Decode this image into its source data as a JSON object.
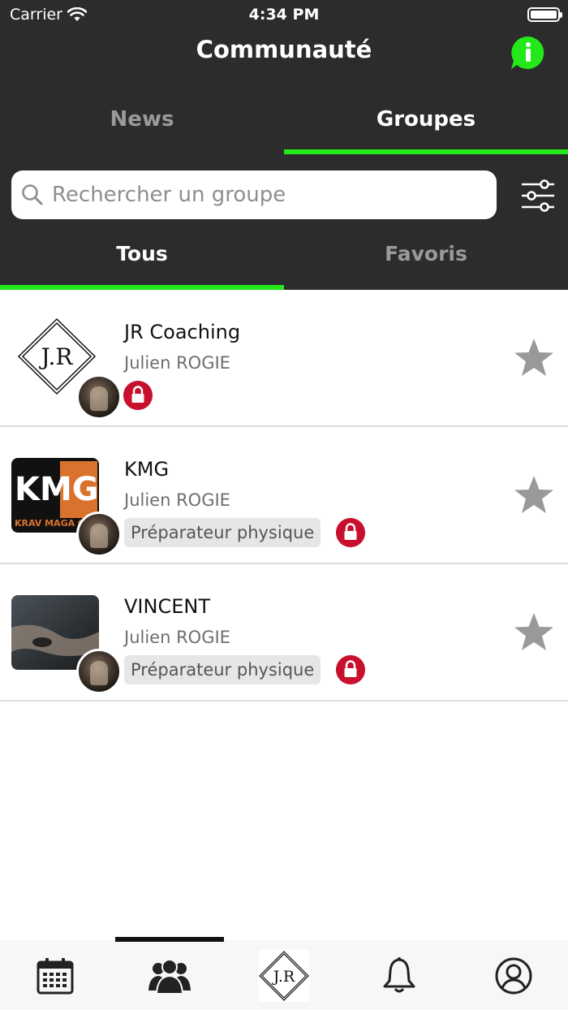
{
  "status_bar": {
    "carrier": "Carrier",
    "time": "4:34 PM"
  },
  "header": {
    "title": "Communauté",
    "info_icon": "info-bubble-icon",
    "accent_color": "#23e81a"
  },
  "top_tabs": [
    {
      "label": "News",
      "active": false
    },
    {
      "label": "Groupes",
      "active": true
    }
  ],
  "search": {
    "placeholder": "Rechercher un groupe",
    "icon": "search-icon",
    "filter_icon": "sliders-icon"
  },
  "sub_tabs": [
    {
      "label": "Tous",
      "active": true
    },
    {
      "label": "Favoris",
      "active": false
    }
  ],
  "groups": [
    {
      "name": "JR Coaching",
      "owner": "Julien ROGIE",
      "tag": "",
      "locked": true,
      "logo_text": "J.R"
    },
    {
      "name": "KMG",
      "owner": "Julien ROGIE",
      "tag": "Préparateur physique",
      "locked": true,
      "logo_text": "KMG",
      "logo_subtext": "KRAV MAGA GLO"
    },
    {
      "name": "VINCENT",
      "owner": "Julien ROGIE",
      "tag": "Préparateur physique",
      "locked": true
    }
  ],
  "tabbar": {
    "items": [
      "calendar-icon",
      "community-icon",
      "jr-logo",
      "bell-icon",
      "profile-icon"
    ],
    "active_index": 1,
    "logo_text": "J.R"
  }
}
